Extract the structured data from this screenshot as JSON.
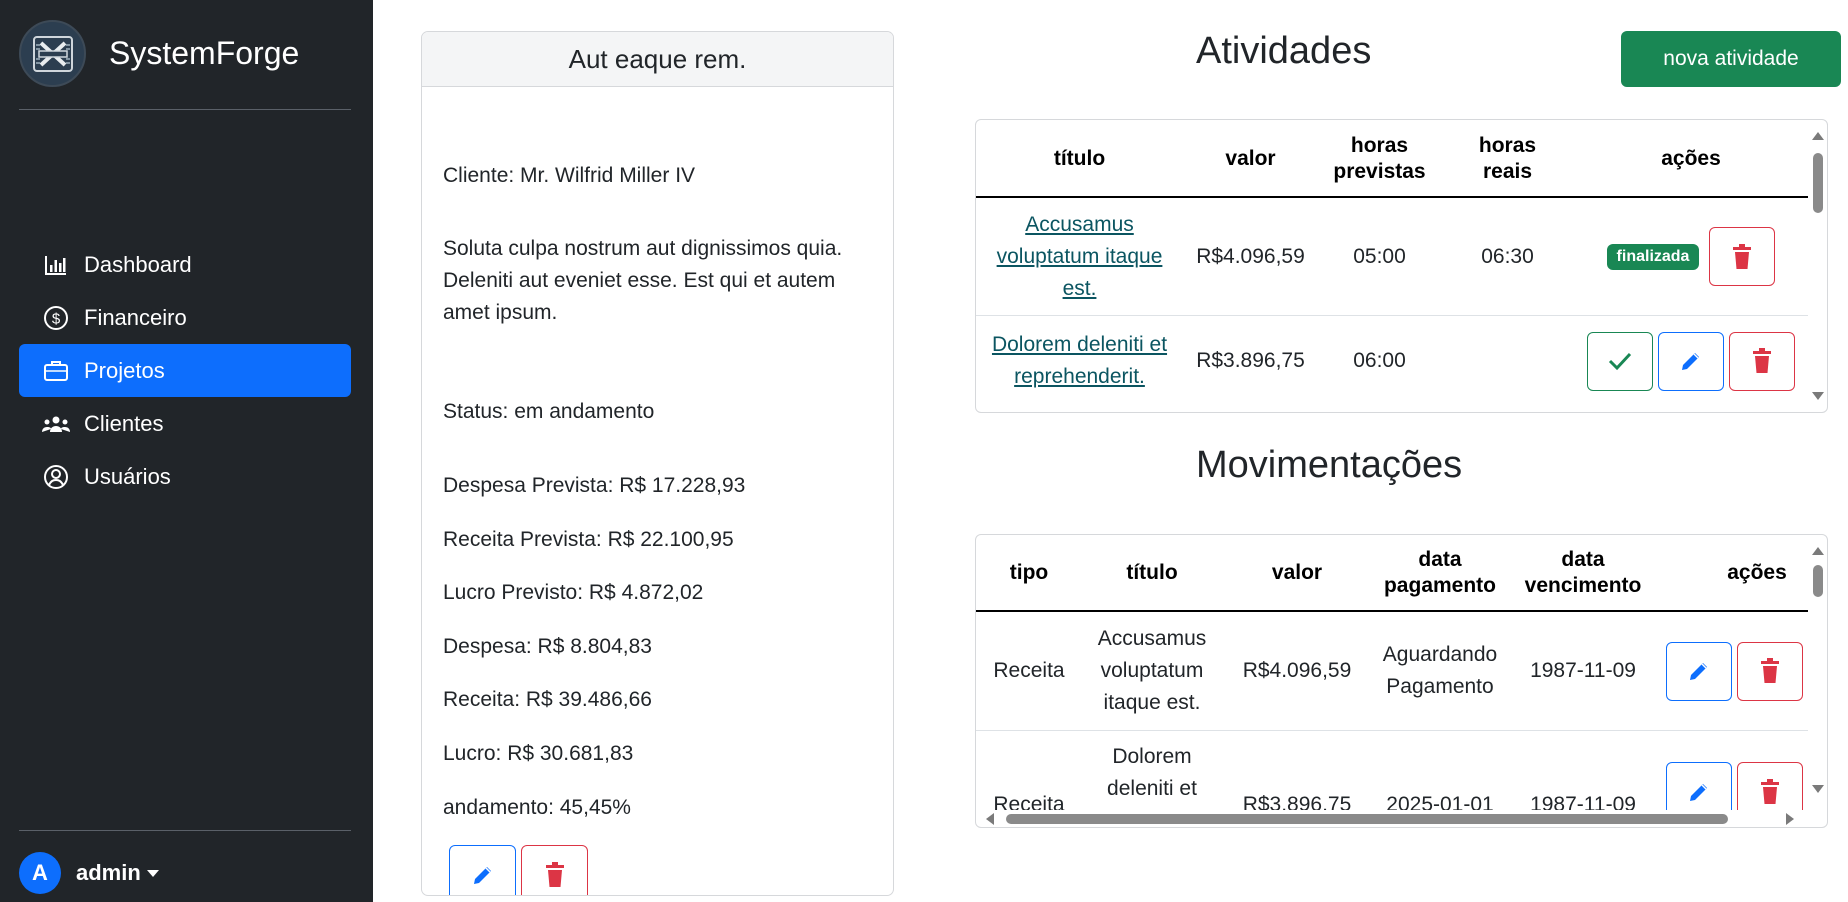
{
  "brand": {
    "name": "SystemForge"
  },
  "sidebar": {
    "items": [
      {
        "label": "Dashboard",
        "icon": "bar-chart-icon"
      },
      {
        "label": "Financeiro",
        "icon": "dollar-circle-icon"
      },
      {
        "label": "Projetos",
        "icon": "briefcase-icon",
        "active": true
      },
      {
        "label": "Clientes",
        "icon": "people-icon"
      },
      {
        "label": "Usuários",
        "icon": "user-circle-icon"
      }
    ],
    "user": {
      "initial": "A",
      "name": "admin"
    }
  },
  "project": {
    "title": "Aut eaque rem.",
    "client": "Cliente: Mr. Wilfrid Miller IV",
    "description": "Soluta culpa nostrum aut dignissimos quia. Deleniti aut eveniet esse. Est qui et autem amet ipsum.",
    "status": "Status: em andamento",
    "despesa_prevista": "Despesa Prevista: R$ 17.228,93",
    "receita_prevista": "Receita Prevista: R$ 22.100,95",
    "lucro_previsto": "Lucro Previsto: R$ 4.872,02",
    "despesa": "Despesa: R$ 8.804,83",
    "receita": "Receita: R$ 39.486,66",
    "lucro": "Lucro: R$ 30.681,83",
    "andamento": "andamento: 45,45%"
  },
  "atividades": {
    "title": "Atividades",
    "new_button": "nova atividade",
    "headers": [
      "título",
      "valor",
      "horas previstas",
      "horas reais",
      "ações"
    ],
    "rows": [
      {
        "titulo": "Accusamus voluptatum itaque est.",
        "valor": "R$4.096,59",
        "horas_previstas": "05:00",
        "horas_reais": "06:30",
        "status": "finalizada"
      },
      {
        "titulo": "Dolorem deleniti et reprehenderit.",
        "valor": "R$3.896,75",
        "horas_previstas": "06:00",
        "horas_reais": ""
      }
    ]
  },
  "movimentacoes": {
    "title": "Movimentações",
    "headers": [
      "tipo",
      "título",
      "valor",
      "data pagamento",
      "data vencimento",
      "ações"
    ],
    "rows": [
      {
        "tipo": "Receita",
        "titulo": "Accusamus voluptatum itaque est.",
        "valor": "R$4.096,59",
        "data_pagamento": "Aguardando Pagamento",
        "data_vencimento": "1987-11-09"
      },
      {
        "tipo": "Receita",
        "titulo": "Dolorem deleniti et",
        "valor": "R$3.896,75",
        "data_pagamento": "2025-01-01",
        "data_vencimento": "1987-11-09"
      }
    ]
  },
  "colors": {
    "primary": "#0d6efd",
    "success": "#198754",
    "danger": "#dc3545",
    "sidebar": "#212529"
  }
}
